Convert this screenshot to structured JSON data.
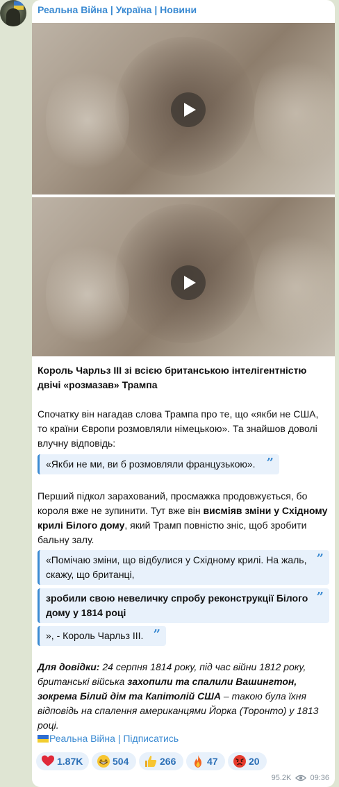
{
  "channel": {
    "name": "Реальна Війна | Україна | Новини"
  },
  "post": {
    "title": "Король Чарльз ІІІ зі всією британською інтелігентністю двічі «розмазав» Трампа",
    "p1": "Спочатку він нагадав слова Трампа про те, що «якби не США, то країни Європи розмовляли німецькою». Та знайшов доволі влучну відповідь:",
    "q1": "«Якби не ми, ви б розмовляли французькою».",
    "p2a": "Перший підкол зарахований, просмажка продовжується, бо короля вже не зупинити. Тут вже він ",
    "p2b": "висміяв зміни у Східному крилі Білого дому",
    "p2c": ", який Трамп повністю зніс, щоб зробити бальну залу.",
    "q2": "«Помічаю зміни, що відбулися у Східному крилі. На жаль, скажу, що британці,",
    "q3": "зробили свою невеличку спробу реконструкції Білого дому у 1814 році",
    "q4": "», - Король Чарльз ІІІ.",
    "note_label": "Для довідки:",
    "note_a": " 24 серпня 1814 року, під час війни 1812 року, британські війська ",
    "note_b": "захопили та спалили Вашингтон, зокрема Білий дім та Капітолій США",
    "note_c": " – такою була їхня відповідь на спалення американцями Йорка (Торонто) у 1813 році.",
    "subscribe": "Реальна Війна | Підписатись"
  },
  "reactions": [
    {
      "emoji": "heart",
      "count": "1.87K"
    },
    {
      "emoji": "grin",
      "count": "504"
    },
    {
      "emoji": "thumbs-up",
      "count": "266"
    },
    {
      "emoji": "fire",
      "count": "47"
    },
    {
      "emoji": "angry",
      "count": "20"
    }
  ],
  "meta": {
    "views": "95.2K",
    "time": "09:36"
  }
}
